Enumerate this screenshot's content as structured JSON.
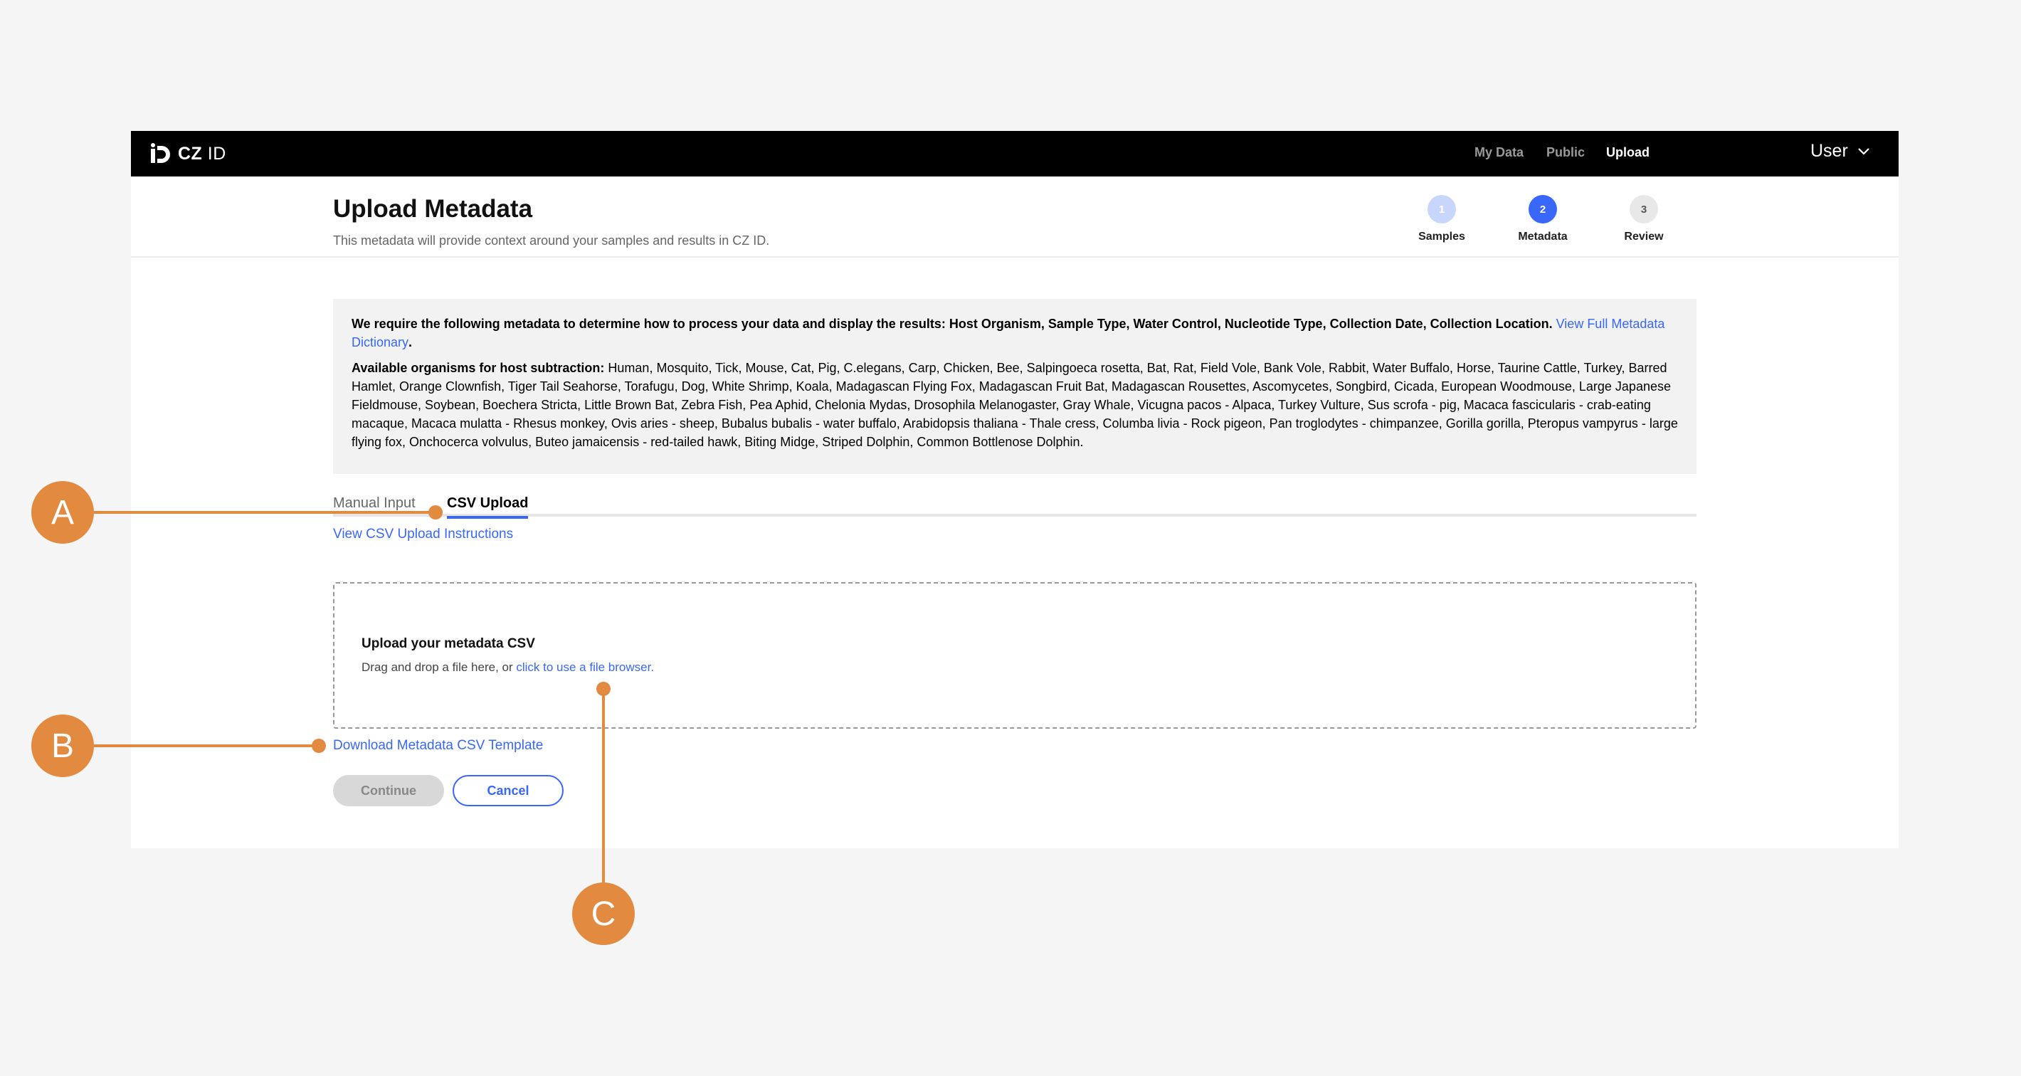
{
  "nav": {
    "logo_bold": "CZ",
    "logo_rest": "ID",
    "links": [
      "My Data",
      "Public",
      "Upload"
    ],
    "user": "User"
  },
  "header": {
    "title": "Upload Metadata",
    "subtitle": "This metadata will provide context around your samples and results in CZ ID.",
    "steps": [
      {
        "number": "1",
        "label": "Samples"
      },
      {
        "number": "2",
        "label": "Metadata"
      },
      {
        "number": "3",
        "label": "Review"
      }
    ]
  },
  "info": {
    "required_text": "We require the following metadata to determine how to process your data and display the results: Host Organism, Sample Type, Water Control, Nucleotide Type, Collection Date, Collection Location.",
    "dictionary_link": "View Full Metadata Dictionary",
    "organisms_label": "Available organisms for host subtraction:",
    "organisms_list": "Human, Mosquito, Tick, Mouse, Cat, Pig, C.elegans, Carp, Chicken, Bee, Salpingoeca rosetta, Bat, Rat, Field Vole, Bank Vole, Rabbit, Water Buffalo, Horse, Taurine Cattle, Turkey, Barred Hamlet, Orange Clownfish, Tiger Tail Seahorse, Torafugu, Dog, White Shrimp, Koala, Madagascan Flying Fox, Madagascan Fruit Bat, Madagascan Rousettes, Ascomycetes, Songbird, Cicada, European Woodmouse, Large Japanese Fieldmouse, Soybean, Boechera Stricta, Little Brown Bat, Zebra Fish, Pea Aphid, Chelonia Mydas, Drosophila Melanogaster, Gray Whale, Vicugna pacos - Alpaca, Turkey Vulture, Sus scrofa - pig, Macaca fascicularis - crab-eating macaque, Macaca mulatta - Rhesus monkey, Ovis aries - sheep, Bubalus bubalis - water buffalo, Arabidopsis thaliana - Thale cress, Columba livia - Rock pigeon, Pan troglodytes - chimpanzee, Gorilla gorilla, Pteropus vampyrus - large flying fox, Onchocerca volvulus, Buteo jamaicensis - red-tailed hawk, Biting Midge, Striped Dolphin, Common Bottlenose Dolphin."
  },
  "tabs": {
    "manual": "Manual Input",
    "csv": "CSV Upload"
  },
  "csv_instructions": "View CSV Upload Instructions",
  "dropzone": {
    "title": "Upload your metadata CSV",
    "desc_prefix": "Drag and drop a file here, or ",
    "desc_link": "click to use a file browser."
  },
  "download_template": "Download Metadata CSV Template",
  "buttons": {
    "continue": "Continue",
    "cancel": "Cancel"
  },
  "annotations": {
    "a": "A",
    "b": "B",
    "c": "C"
  },
  "colors": {
    "accent": "#3867fa",
    "annotation": "#e28a3f"
  }
}
